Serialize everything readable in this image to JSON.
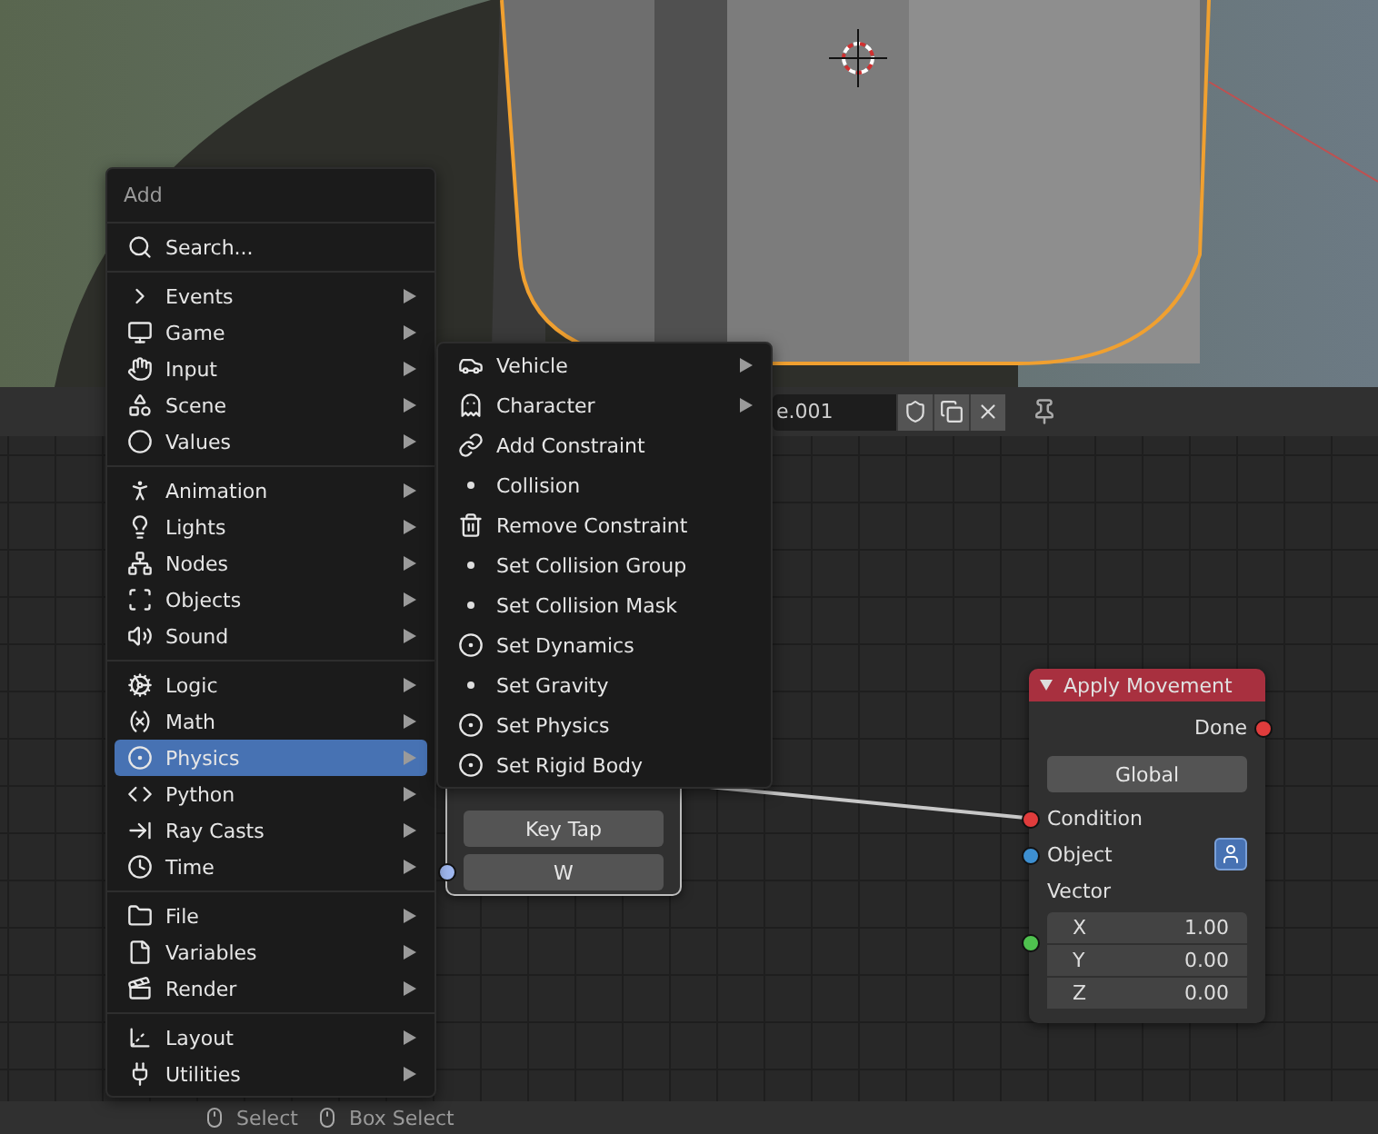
{
  "header": {
    "datablock_value": "e.001"
  },
  "add_menu": {
    "title": "Add",
    "search": "Search...",
    "groups": [
      {
        "items": [
          {
            "label": "Events",
            "selected": false
          },
          {
            "label": "Game",
            "selected": false
          },
          {
            "label": "Input",
            "selected": false
          },
          {
            "label": "Scene",
            "selected": false
          },
          {
            "label": "Values",
            "selected": false
          }
        ]
      },
      {
        "items": [
          {
            "label": "Animation",
            "selected": false
          },
          {
            "label": "Lights",
            "selected": false
          },
          {
            "label": "Nodes",
            "selected": false
          },
          {
            "label": "Objects",
            "selected": false
          },
          {
            "label": "Sound",
            "selected": false
          }
        ]
      },
      {
        "items": [
          {
            "label": "Logic",
            "selected": false
          },
          {
            "label": "Math",
            "selected": false
          },
          {
            "label": "Physics",
            "selected": true
          },
          {
            "label": "Python",
            "selected": false
          },
          {
            "label": "Ray Casts",
            "selected": false
          },
          {
            "label": "Time",
            "selected": false
          }
        ]
      },
      {
        "items": [
          {
            "label": "File",
            "selected": false
          },
          {
            "label": "Variables",
            "selected": false
          },
          {
            "label": "Render",
            "selected": false
          }
        ]
      },
      {
        "items": [
          {
            "label": "Layout",
            "selected": false
          },
          {
            "label": "Utilities",
            "selected": false
          }
        ]
      }
    ]
  },
  "physics_submenu": {
    "items": [
      {
        "label": "Vehicle",
        "has_submenu": true
      },
      {
        "label": "Character",
        "has_submenu": true
      },
      {
        "label": "Add Constraint",
        "has_submenu": false
      },
      {
        "label": "Collision",
        "has_submenu": false
      },
      {
        "label": "Remove Constraint",
        "has_submenu": false
      },
      {
        "label": "Set Collision Group",
        "has_submenu": false
      },
      {
        "label": "Set Collision Mask",
        "has_submenu": false
      },
      {
        "label": "Set Dynamics",
        "has_submenu": false
      },
      {
        "label": "Set Gravity",
        "has_submenu": false
      },
      {
        "label": "Set Physics",
        "has_submenu": false
      },
      {
        "label": "Set Rigid Body",
        "has_submenu": false
      }
    ]
  },
  "key_node": {
    "buttons": [
      "Key Tap",
      "W"
    ]
  },
  "apply_node": {
    "title": "Apply Movement",
    "expanded": true,
    "output": {
      "label": "Done",
      "color": "#e03c3c"
    },
    "mode": "Global",
    "inputs": [
      {
        "label": "Condition",
        "color": "#e03c3c"
      },
      {
        "label": "Object",
        "color": "#3d8fd1"
      },
      {
        "label": "Vector",
        "color": "#4fc24f"
      }
    ],
    "vector": [
      {
        "axis": "X",
        "value": "1.00"
      },
      {
        "axis": "Y",
        "value": "0.00"
      },
      {
        "axis": "Z",
        "value": "0.00"
      }
    ]
  },
  "status_bar": {
    "items": [
      "Select",
      "Box Select"
    ]
  }
}
